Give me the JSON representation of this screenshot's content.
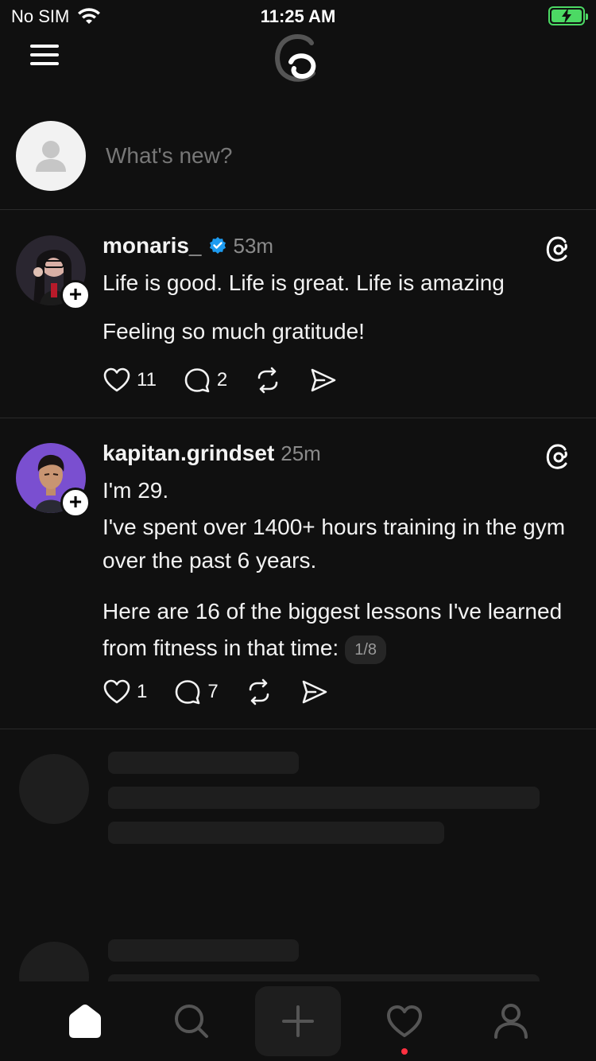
{
  "status_bar": {
    "carrier": "No SIM",
    "time": "11:25 AM"
  },
  "composer": {
    "placeholder": "What's new?"
  },
  "posts": [
    {
      "username": "monaris_",
      "verified": true,
      "time": "53m",
      "paragraphs": [
        "Life is good. Life is great. Life is amazing",
        "Feeling so much gratitude!"
      ],
      "likes": "11",
      "replies": "2"
    },
    {
      "username": "kapitan.grindset",
      "verified": false,
      "time": "25m",
      "paragraphs": [
        "I'm 29.",
        "I've spent over 1400+ hours training in the gym over the past 6 years.",
        "Here are 16 of the biggest lessons I've learned from fitness in that time:"
      ],
      "page_indicator": "1/8",
      "likes": "1",
      "replies": "7"
    }
  ],
  "tab_bar": {
    "items": [
      "home-icon",
      "search-icon",
      "create-icon",
      "activity-icon",
      "profile-icon"
    ],
    "active": "home-icon"
  },
  "colors": {
    "background": "#101010",
    "verified": "#1d9bf0",
    "notification_dot": "#ff3040",
    "battery": "#4cd964"
  }
}
